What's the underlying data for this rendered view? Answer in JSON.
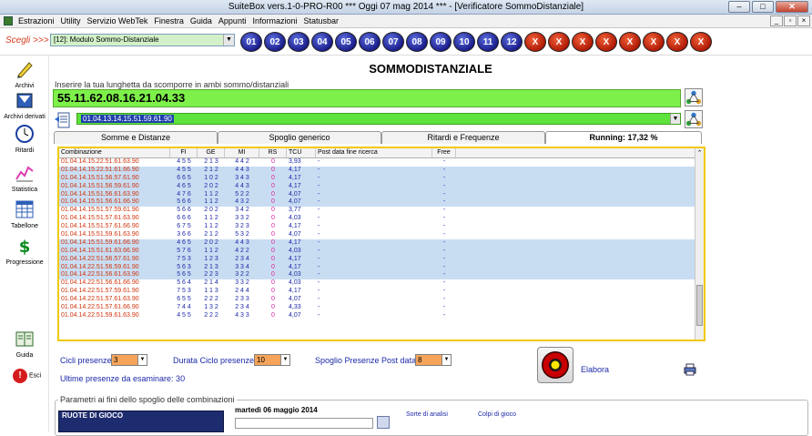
{
  "window": {
    "title": "SuiteBox vers.1-0-PRO-R00  ***  Oggi 07 mag 2014  ***   - [Verificatore SommoDistanziale]"
  },
  "menu": [
    "Estrazioni",
    "Utility",
    "Servizio WebTek",
    "Finestra",
    "Guida",
    "Appunti",
    "Informazioni",
    "Statusbar"
  ],
  "toolbar": {
    "scegli_label": "Scegli >>>",
    "module_value": "[12]: Modulo Sommo-Distanziale",
    "wheels": [
      "01",
      "02",
      "03",
      "04",
      "05",
      "06",
      "07",
      "08",
      "09",
      "10",
      "11",
      "12",
      "X",
      "X",
      "X",
      "X",
      "X",
      "X",
      "X",
      "X"
    ]
  },
  "sidebar": [
    {
      "label": "Archivi",
      "icon": "pencil-icon"
    },
    {
      "label": "Archivi derivati",
      "icon": "database-icon"
    },
    {
      "label": "Ritardi",
      "icon": "clock-icon"
    },
    {
      "label": "Statistica",
      "icon": "chart-icon"
    },
    {
      "label": "Tabellone",
      "icon": "calendar-grid-icon"
    },
    {
      "label": "Progressione",
      "icon": "dollar-icon"
    },
    {
      "label": "Guida",
      "icon": "book-icon"
    },
    {
      "label": "Esci",
      "icon": "exit-icon"
    }
  ],
  "main": {
    "heading": "SOMMODISTANZIALE",
    "lunghezza_label": "Inserire la tua lunghetta da scomporre in ambi sommo/distanziali",
    "lunghezza_value": "55.11.62.08.16.21.04.33",
    "combo_value": "01.04.13.14.15.51.59.61.90",
    "tabs": [
      "Somme e Distanze",
      "Spoglio generico",
      "Ritardi e Frequenze",
      "Running: 17,32 %"
    ]
  },
  "table": {
    "headers": [
      "Combinazione",
      "FI",
      "GE",
      "MI",
      "RS",
      "TCU",
      "Post data fine ricerca",
      "Free"
    ],
    "rows": [
      [
        "01.04.14.15.22.51.61.63.90",
        "4 5 5",
        "2 1 3",
        "4 4 2",
        "0",
        "3,93",
        "-",
        "-"
      ],
      [
        "01.04.14.15.22.51.61.66.90",
        "4 5 5",
        "2 1 2",
        "4 4 3",
        "0",
        "4,17",
        "-",
        "-"
      ],
      [
        "01.04.14.15.51.56.57.61.90",
        "6 6 5",
        "1 0 2",
        "3 4 3",
        "0",
        "4,17",
        "-",
        "-"
      ],
      [
        "01.04.14.15.51.56.59.61.90",
        "4 6 5",
        "2 0 2",
        "4 4 3",
        "0",
        "4,17",
        "-",
        "-"
      ],
      [
        "01.04.14.15.51.56.61.63.90",
        "4 7 6",
        "1 1 2",
        "5 2 2",
        "0",
        "4,07",
        "-",
        "-"
      ],
      [
        "01.04.14.15.51.56.61.66.90",
        "5 6 6",
        "1 1 2",
        "4 3 2",
        "0",
        "4,07",
        "-",
        "-"
      ],
      [
        "01.04.14.15.51.57.59.61.90",
        "5 6 6",
        "2 0 2",
        "3 4 2",
        "0",
        "3,77",
        "-",
        "-"
      ],
      [
        "01.04.14.15.51.57.61.63.90",
        "6 6 6",
        "1 1 2",
        "3 3 2",
        "0",
        "4,03",
        "-",
        "-"
      ],
      [
        "01.04.14.15.51.57.61.66.90",
        "6 7 5",
        "1 1 2",
        "3 2 3",
        "0",
        "4,17",
        "-",
        "-"
      ],
      [
        "01.04.14.15.51.59.61.63.90",
        "3 6 6",
        "2 1 2",
        "5 3 2",
        "0",
        "4,07",
        "-",
        "-"
      ],
      [
        "01.04.14.15.51.59.61.66.90",
        "4 6 5",
        "2 0 2",
        "4 4 3",
        "0",
        "4,17",
        "-",
        "-"
      ],
      [
        "01.04.14.15.51.61.63.66.90",
        "5 7 6",
        "1 1 2",
        "4 2 2",
        "0",
        "4,03",
        "-",
        "-"
      ],
      [
        "01.04.14.22.51.56.57.61.90",
        "7 5 3",
        "1 2 3",
        "2 3 4",
        "0",
        "4,17",
        "-",
        "-"
      ],
      [
        "01.04.14.22.51.56.59.61.90",
        "5 6 3",
        "2 1 3",
        "3 3 4",
        "0",
        "4,17",
        "-",
        "-"
      ],
      [
        "01.04.14.22.51.56.61.63.90",
        "5 6 5",
        "2 2 3",
        "3 2 2",
        "0",
        "4,03",
        "-",
        "-"
      ],
      [
        "01.04.14.22.51.56.61.66.90",
        "5 6 4",
        "2 1 4",
        "3 3 2",
        "0",
        "4,03",
        "-",
        "-"
      ],
      [
        "01.04.14.22.51.57.59.61.90",
        "7 5 3",
        "1 1 3",
        "2 4 4",
        "0",
        "4,17",
        "-",
        "-"
      ],
      [
        "01.04.14.22.51.57.61.63.90",
        "6 5 5",
        "2 2 2",
        "2 3 3",
        "0",
        "4,07",
        "-",
        "-"
      ],
      [
        "01.04.14.22.51.57.61.66.90",
        "7 4 4",
        "1 3 2",
        "2 3 4",
        "0",
        "4,33",
        "-",
        "-"
      ],
      [
        "01.04.14.22.51.59.61.63.90",
        "4 5 5",
        "2 2 2",
        "4 3 3",
        "0",
        "4,07",
        "-",
        "-"
      ]
    ],
    "highlighted_rows": [
      1,
      2,
      3,
      4,
      5,
      10,
      11,
      12,
      13,
      14
    ]
  },
  "controls": {
    "cicli_label": "Cicli presenze:",
    "cicli_value": "3",
    "durata_label": "Durata Ciclo presenze:",
    "durata_value": "10",
    "spoglio_label": "Spoglio Presenze Post data:",
    "spoglio_value": "8",
    "ultime_label": "Ultime presenze da esaminare: 30",
    "elabora_label": "Elabora"
  },
  "params": {
    "label": "Parametri ai fini dello spoglio delle combinazioni",
    "ruote_label": "RUOTE DI GIOCO",
    "date_label": "martedì 06 maggio 2014",
    "sorte_label": "Sorte di analisi",
    "colpi_label": "Colpi di gioco"
  }
}
